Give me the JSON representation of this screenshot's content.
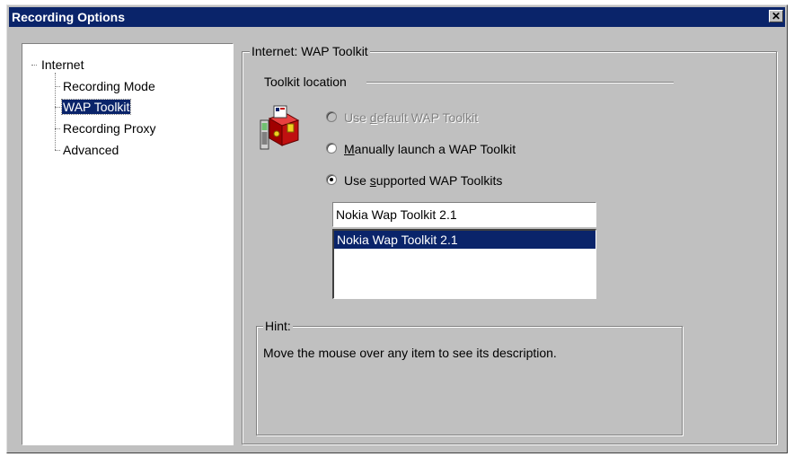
{
  "window": {
    "title": "Recording Options",
    "close_symbol": "✕"
  },
  "tree": {
    "root": "Internet",
    "items": [
      {
        "label": "Recording Mode",
        "selected": false
      },
      {
        "label": "WAP Toolkit",
        "selected": true
      },
      {
        "label": "Recording Proxy",
        "selected": false
      },
      {
        "label": "Advanced",
        "selected": false
      }
    ]
  },
  "panel": {
    "group_title": "Internet: WAP Toolkit",
    "section_title": "Toolkit location",
    "icon": "wap-toolkit-icon",
    "radios": [
      {
        "label_pre": "Use ",
        "label_key": "d",
        "label_post": "efault WAP Toolkit",
        "checked": false,
        "disabled": true
      },
      {
        "label_pre": "",
        "label_key": "M",
        "label_post": "anually launch a WAP Toolkit",
        "checked": false,
        "disabled": false
      },
      {
        "label_pre": "Use ",
        "label_key": "s",
        "label_post": "upported WAP Toolkits",
        "checked": true,
        "disabled": false
      }
    ],
    "toolkit_input_value": "Nokia Wap Toolkit 2.1",
    "toolkit_list": [
      {
        "label": "Nokia Wap Toolkit 2.1",
        "selected": true
      }
    ]
  },
  "hint": {
    "title": "Hint:",
    "text": "Move the mouse over any item to see its description."
  },
  "colors": {
    "titlebar": "#0a246a",
    "face": "#c0c0c0",
    "selection": "#0a246a"
  }
}
